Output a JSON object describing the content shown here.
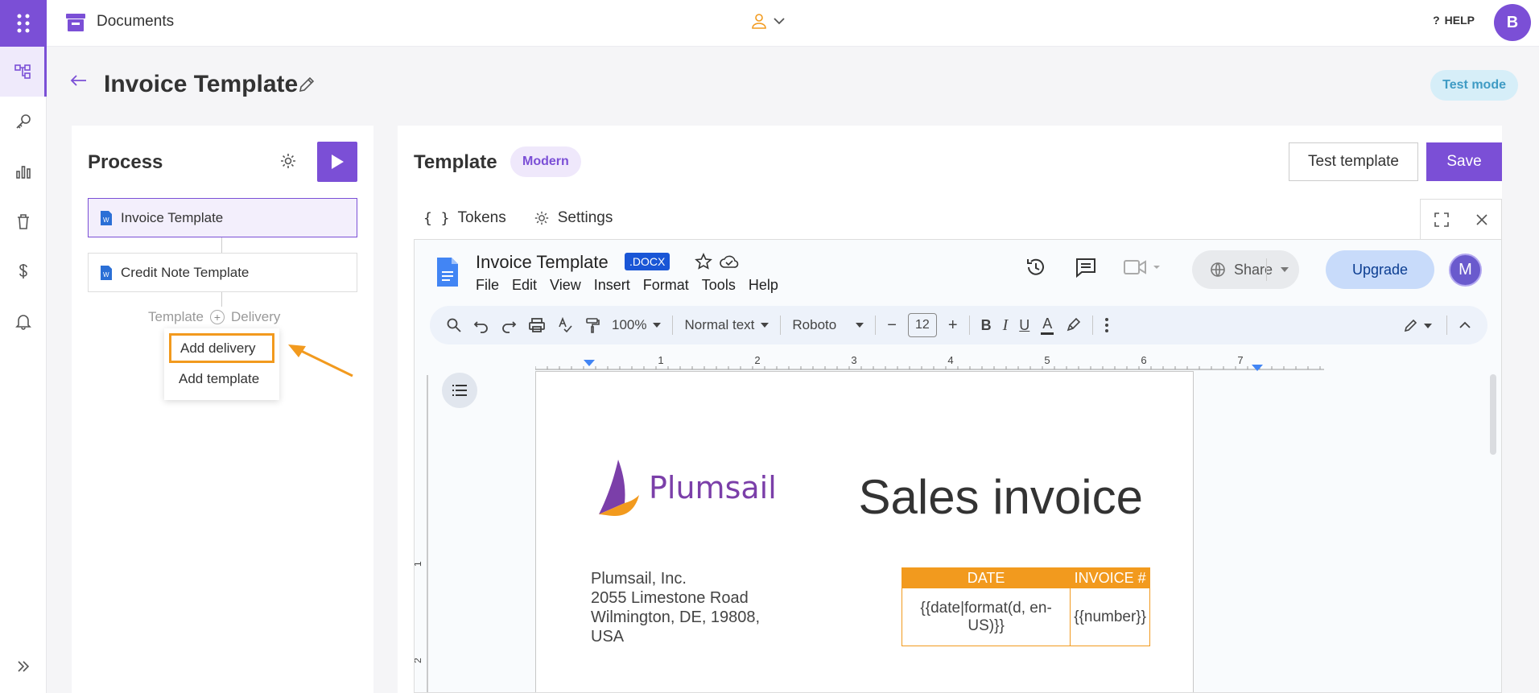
{
  "header": {
    "app_title": "Documents",
    "help_label": "HELP",
    "user_initial": "B"
  },
  "page": {
    "title": "Invoice Template",
    "mode_badge": "Test mode"
  },
  "process": {
    "title": "Process",
    "items": [
      {
        "label": "Invoice Template"
      },
      {
        "label": "Credit Note Template"
      }
    ],
    "add_row": {
      "left": "Template",
      "right": "Delivery"
    },
    "dropdown": [
      "Add delivery",
      "Add template"
    ]
  },
  "template": {
    "title": "Template",
    "style_badge": "Modern",
    "test_button": "Test template",
    "save_button": "Save",
    "tabs": [
      {
        "label": "Tokens"
      },
      {
        "label": "Settings"
      }
    ]
  },
  "editor": {
    "doc_name": "Invoice Template",
    "doc_badge": ".DOCX",
    "menu": [
      "File",
      "Edit",
      "View",
      "Insert",
      "Format",
      "Tools",
      "Help"
    ],
    "share_label": "Share",
    "upgrade_label": "Upgrade",
    "user_initial": "M",
    "toolbar": {
      "zoom": "100%",
      "style": "Normal text",
      "font": "Roboto",
      "font_size": "12"
    },
    "ruler_h": [
      "1",
      "2",
      "3",
      "4",
      "5",
      "6",
      "7"
    ],
    "ruler_v": [
      "1",
      "2"
    ]
  },
  "document": {
    "logo_text": "Plumsail",
    "heading": "Sales invoice",
    "address": [
      "Plumsail, Inc.",
      "2055 Limestone Road",
      "Wilmington, DE, 19808,",
      "USA"
    ],
    "table": {
      "headers": [
        "DATE",
        "INVOICE #"
      ],
      "cells": [
        "{{date|format(d, en-US)}}",
        "{{number}}"
      ]
    }
  },
  "colors": {
    "accent": "#7b4fd6",
    "annotation": "#f29a1e",
    "table_header": "#f29a1e"
  }
}
